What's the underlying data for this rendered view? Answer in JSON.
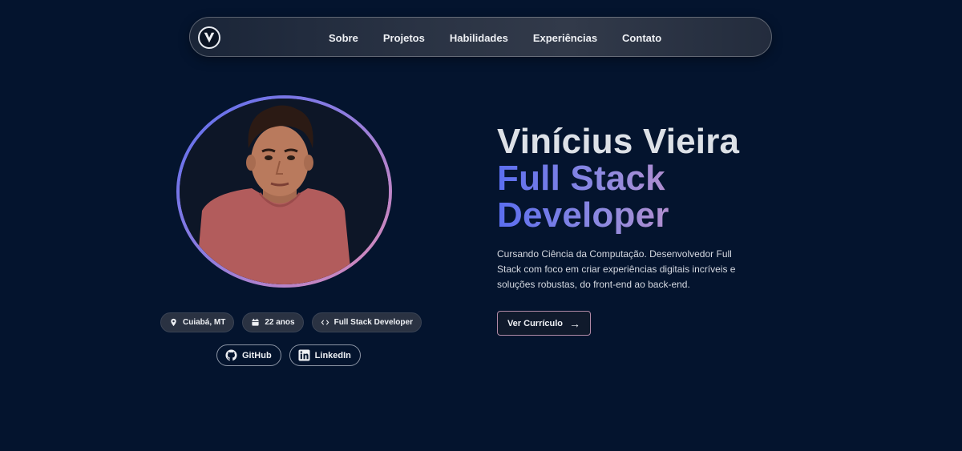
{
  "nav": {
    "logo_letter": "V",
    "links": [
      "Sobre",
      "Projetos",
      "Habilidades",
      "Experiências",
      "Contato"
    ]
  },
  "profile": {
    "chips": [
      {
        "icon": "map-pin-icon",
        "label": "Cuiabá, MT"
      },
      {
        "icon": "calendar-icon",
        "label": "22 anos"
      },
      {
        "icon": "code-icon",
        "label": "Full Stack Developer"
      }
    ],
    "social": [
      {
        "icon": "github-icon",
        "label": "GitHub"
      },
      {
        "icon": "linkedin-icon",
        "label": "LinkedIn"
      }
    ]
  },
  "hero": {
    "name": "Vinícius Vieira",
    "role_line1": "Full Stack",
    "role_line2": "Developer",
    "description": "Cursando Ciência da Computação. Desenvolvedor Full Stack com foco em criar experiências digitais incríveis e soluções robustas, do front-end ao back-end.",
    "cv_button": "Ver Currículo"
  },
  "colors": {
    "background": "#04142e",
    "gradient_start": "#5b6ef0",
    "gradient_end": "#d893bd"
  }
}
